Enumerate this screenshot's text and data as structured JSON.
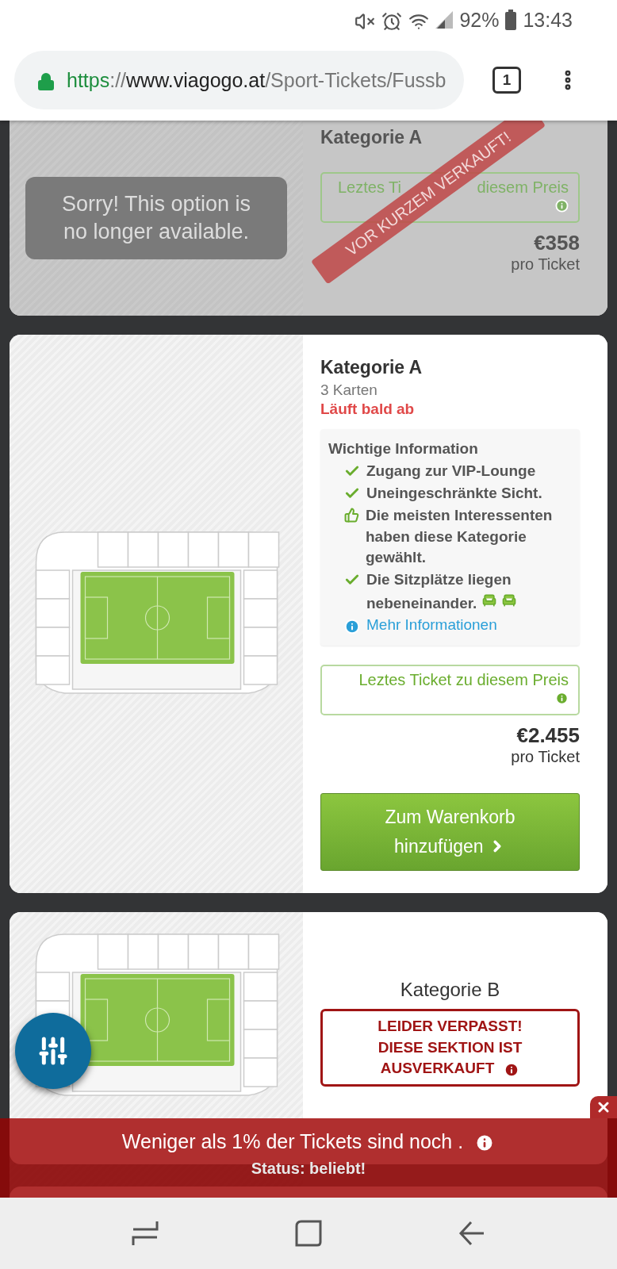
{
  "status_bar": {
    "battery": "92%",
    "time": "13:43"
  },
  "browser": {
    "url_scheme": "https",
    "url_separator": "://",
    "url_host": "www.viagogo.at",
    "url_path": "/Sport-Tickets/Fussb",
    "tab_count": "1"
  },
  "listings": [
    {
      "kind": "unavailable",
      "message": "Sorry! This option is no longer available.",
      "category": "Kategorie A",
      "notice_parts": [
        "Leztes Ti",
        "diesem Preis"
      ],
      "price": "€358",
      "price_unit": "pro Ticket",
      "stamp": "VOR KURZEM VERKAUFT!"
    },
    {
      "kind": "available",
      "category": "Kategorie A",
      "quantity": "3 Karten",
      "urgency": "Läuft bald ab",
      "info": {
        "title": "Wichtige Information",
        "items": [
          {
            "kind": "check",
            "text": "Zugang zur VIP-Lounge"
          },
          {
            "kind": "check",
            "text": "Uneingeschränkte Sicht."
          },
          {
            "kind": "thumb",
            "text": "Die meisten Interessenten haben diese Kategorie gewählt."
          },
          {
            "kind": "check-seats",
            "text": "Die Sitzplätze liegen nebeneinander."
          }
        ],
        "link": "Mehr Informationen"
      },
      "notice": "Leztes Ticket zu diesem Preis",
      "price": "€2.455",
      "price_unit": "pro Ticket",
      "button": "Zum Warenkorb hinzufügen"
    },
    {
      "kind": "sold_out",
      "category": "Kategorie B",
      "alert_lines": [
        "LEIDER VERPASST!",
        "DIESE SEKTION IST",
        "AUSVERKAUFT"
      ]
    }
  ],
  "banner": {
    "text": "Weniger als 1% der Tickets sind noch .",
    "status": "Status: beliebt!"
  }
}
